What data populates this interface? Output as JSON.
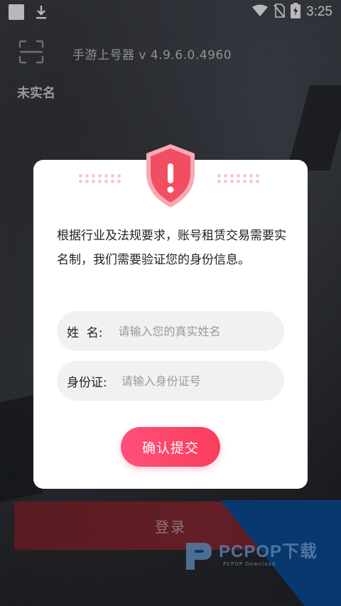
{
  "status_bar": {
    "time": "3:25",
    "icons": [
      "square-icon",
      "download-icon",
      "wifi-icon",
      "no-sim-icon",
      "battery-charging-icon"
    ]
  },
  "header": {
    "scan_icon": "scan-icon",
    "app_title": "手游上号器 v 4.9.6.0.4960",
    "realname_status": "未实名"
  },
  "dialog": {
    "icon": "shield-alert-icon",
    "message": "根据行业及法规要求，账号租赁交易需要实名制，我们需要验证您的身份信息。",
    "name_field": {
      "label": "姓  名:",
      "placeholder": "请输入您的真实姓名",
      "value": ""
    },
    "id_field": {
      "label": "身份证:",
      "placeholder": "请输入身份证号",
      "value": ""
    },
    "confirm_label": "确认提交"
  },
  "login": {
    "label": "登录"
  },
  "watermark": {
    "main": "PCPOP下载",
    "sub": "PCPOP Download"
  },
  "colors": {
    "accent": "#fb3d5a",
    "shield": "#f24e62",
    "login_bar": "#9b2a36",
    "watermark_blue": "#0a4f9c"
  }
}
